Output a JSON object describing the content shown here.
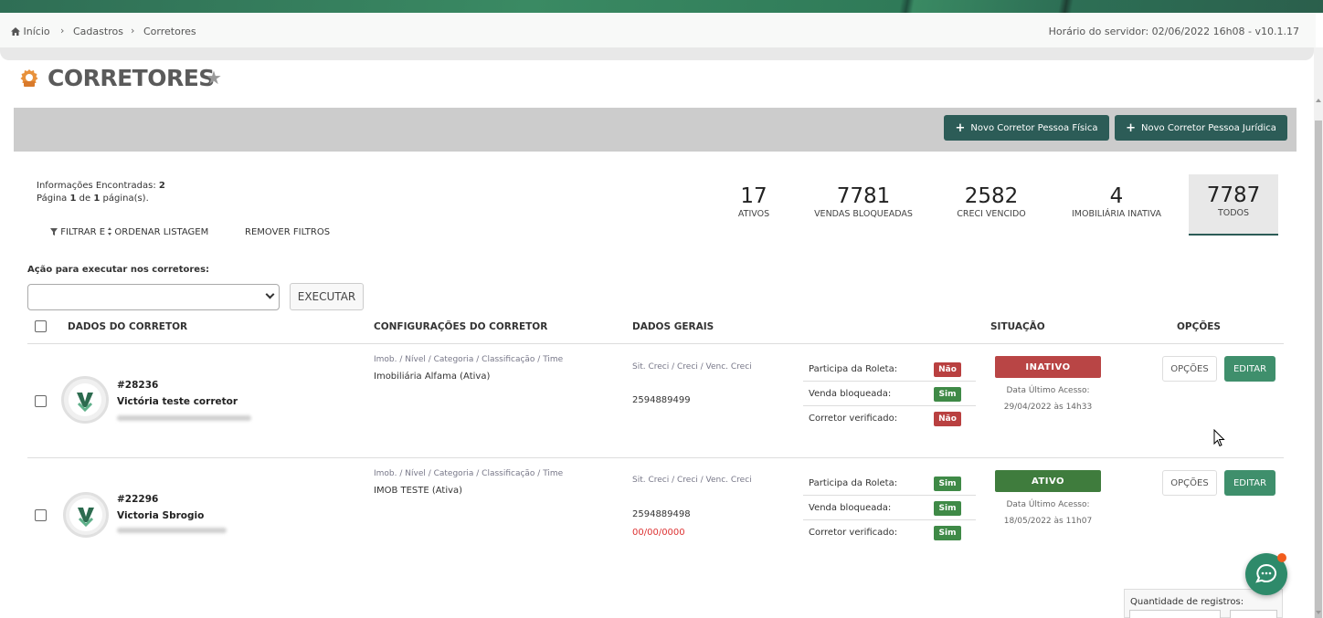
{
  "breadcrumb": {
    "home": "Início",
    "items": [
      "Cadastros",
      "Corretores"
    ]
  },
  "server_time": "Horário do servidor: 02/06/2022 16h08 - v10.1.17",
  "page": {
    "title": "CORRETORES"
  },
  "actions": {
    "new_pf": "Novo Corretor Pessoa Física",
    "new_pj": "Novo Corretor Pessoa Jurídica"
  },
  "info": {
    "found_label": "Informações Encontradas:",
    "found_count": "2",
    "page_prefix": "Página",
    "page_current": "1",
    "page_of": "de",
    "page_total": "1",
    "page_suffix": "página(s)."
  },
  "links": {
    "filter_part1": "FILTRAR E",
    "filter_part2": "ORDENAR LISTAGEM",
    "remove": "REMOVER FILTROS"
  },
  "stats": [
    {
      "num": "17",
      "label": "ATIVOS"
    },
    {
      "num": "7781",
      "label": "VENDAS BLOQUEADAS"
    },
    {
      "num": "2582",
      "label": "CRECI VENCIDO"
    },
    {
      "num": "4",
      "label": "IMOBILIÁRIA INATIVA"
    },
    {
      "num": "7787",
      "label": "TODOS"
    }
  ],
  "bulk": {
    "label": "Ação para executar nos corretores:",
    "execute": "EXECUTAR"
  },
  "table": {
    "headers": [
      "DADOS DO CORRETOR",
      "CONFIGURAÇÕES DO CORRETOR",
      "DADOS GERAIS",
      "SITUAÇÃO",
      "OPÇÕES"
    ],
    "config_caption": "Imob. / Nível / Categoria / Classificação / Time",
    "general_caption": "Sit. Creci / Creci / Venc. Creci",
    "flag_labels": [
      "Participa da Roleta:",
      "Venda bloqueada:",
      "Corretor verificado:"
    ],
    "access_label": "Data Último Acesso:",
    "options_btn": "OPÇÕES",
    "edit_btn": "EDITAR",
    "rows": [
      {
        "id": "#28236",
        "name": "Victória teste corretor",
        "config": "Imobiliária Alfama (Ativa)",
        "creci": "2594889499",
        "creci_due": "",
        "flags": [
          "Não",
          "Sim",
          "Não"
        ],
        "status": "INATIVO",
        "last_access": "29/04/2022 às 14h33"
      },
      {
        "id": "#22296",
        "name": "Victoria Sbrogio",
        "config": "IMOB TESTE (Ativa)",
        "creci": "2594889498",
        "creci_due": "00/00/0000",
        "flags": [
          "Sim",
          "Sim",
          "Sim"
        ],
        "status": "ATIVO",
        "last_access": "18/05/2022 às 11h07"
      }
    ]
  },
  "footer": {
    "qty_label": "Quantidade de registros:"
  }
}
